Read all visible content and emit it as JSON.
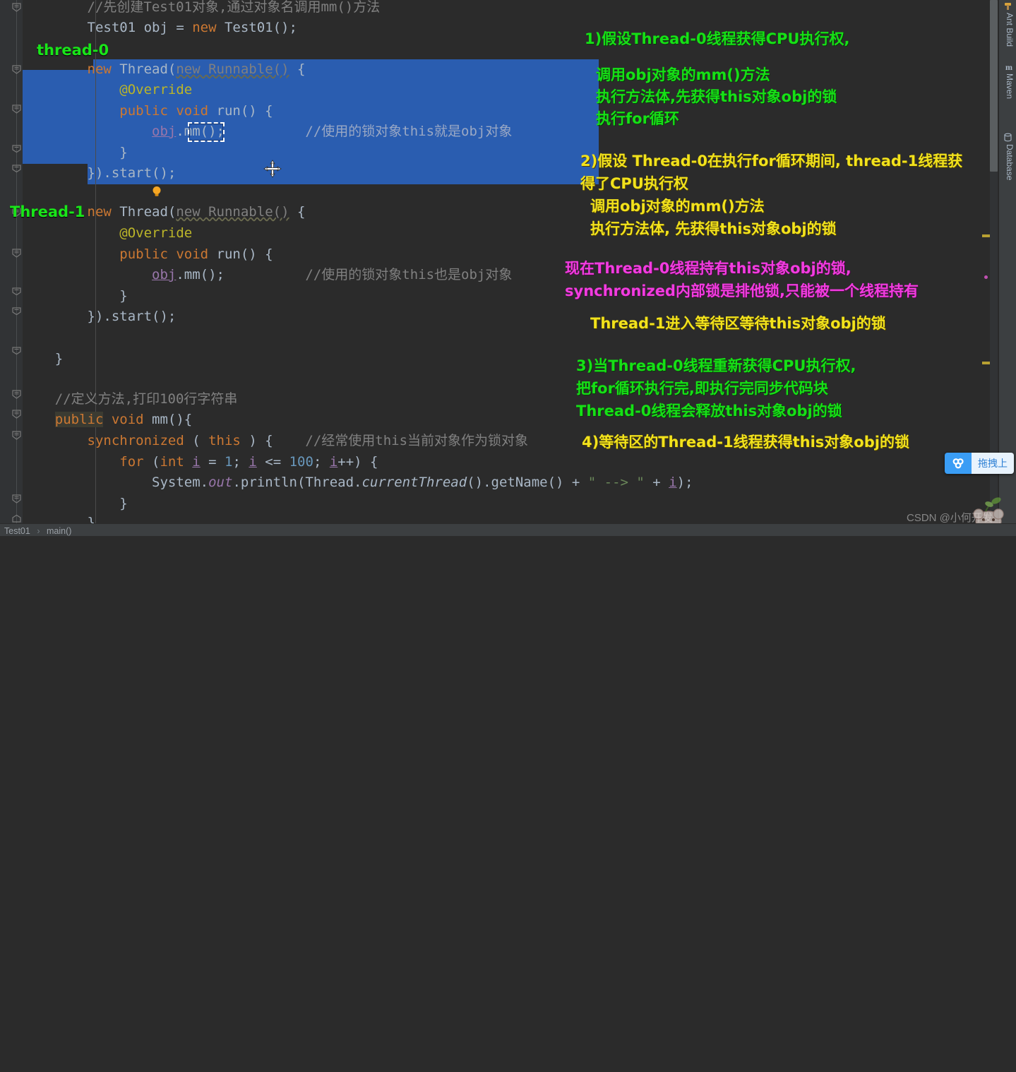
{
  "app": {
    "theme_bg": "#2b2b2b",
    "selection_color": "#2a5db0",
    "accent_green": "#16e016",
    "accent_yellow": "#f2e21c",
    "accent_magenta": "#f23ce0"
  },
  "editor": {
    "lines": [
      {
        "id": "l1",
        "text": "        //先创建Test01对象,通过对象名调用mm()方法"
      },
      {
        "id": "l2",
        "text": "        Test01 obj = new Test01();"
      },
      {
        "id": "l3",
        "text": ""
      },
      {
        "id": "l4",
        "text": "        new Thread(new Runnable() {"
      },
      {
        "id": "l5",
        "text": "            @Override"
      },
      {
        "id": "l6",
        "text": "            public void run() {"
      },
      {
        "id": "l7",
        "text": "                obj.mm();          //使用的锁对象this就是obj对象"
      },
      {
        "id": "l8",
        "text": "            }"
      },
      {
        "id": "l9",
        "text": "        }).start();"
      },
      {
        "id": "l10",
        "text": ""
      },
      {
        "id": "l11",
        "text": "        new Thread(new Runnable() {"
      },
      {
        "id": "l12",
        "text": "            @Override"
      },
      {
        "id": "l13",
        "text": "            public void run() {"
      },
      {
        "id": "l14",
        "text": "                obj.mm();          //使用的锁对象this也是obj对象"
      },
      {
        "id": "l15",
        "text": "            }"
      },
      {
        "id": "l16",
        "text": "        }).start();"
      },
      {
        "id": "l17",
        "text": ""
      },
      {
        "id": "l18",
        "text": "    }"
      },
      {
        "id": "l19",
        "text": ""
      },
      {
        "id": "l20",
        "text": "    //定义方法,打印100行字符串"
      },
      {
        "id": "l21",
        "text": "    public void mm(){"
      },
      {
        "id": "l22",
        "text": "        synchronized ( this ) {    //经常使用this当前对象作为锁对象"
      },
      {
        "id": "l23",
        "text": "            for (int i = 1; i <= 100; i++) {"
      },
      {
        "id": "l24",
        "text": "                System.out.println(Thread.currentThread().getName() + \" --> \" + i);"
      },
      {
        "id": "l25",
        "text": "            }"
      },
      {
        "id": "l26",
        "text": "        }"
      }
    ],
    "comment_l1": "//先创建Test01对象,通过对象名调用mm()方法",
    "comment_l7": "//使用的锁对象this就是obj对象",
    "comment_l14": "//使用的锁对象this也是obj对象",
    "comment_l20": "//定义方法,打印100行字符串",
    "comment_l22": "//经常使用this当前对象作为锁对象",
    "selected_token": "obj"
  },
  "thread_labels": {
    "thread0": "thread-0",
    "thread1": "Thread-1"
  },
  "annotations": [
    {
      "id": "a1",
      "color": "green",
      "text": "1)假设Thread-0线程获得CPU执行权,"
    },
    {
      "id": "a2",
      "color": "green",
      "text": "调用obj对象的mm()方法"
    },
    {
      "id": "a3",
      "color": "green",
      "text": "执行方法体,先获得this对象obj的锁"
    },
    {
      "id": "a4",
      "color": "green",
      "text": "执行for循环"
    },
    {
      "id": "a5",
      "color": "yellow",
      "text": "2)假设 Thread-0在执行for循环期间, thread-1线程获"
    },
    {
      "id": "a6",
      "color": "yellow",
      "text": "得了CPU执行权"
    },
    {
      "id": "a7",
      "color": "yellow",
      "text": "调用obj对象的mm()方法"
    },
    {
      "id": "a8",
      "color": "yellow",
      "text": "执行方法体, 先获得this对象obj的锁"
    },
    {
      "id": "a9",
      "color": "magenta",
      "text": "现在Thread-0线程持有this对象obj的锁,"
    },
    {
      "id": "a10",
      "color": "magenta",
      "text": "synchronized内部锁是排他锁,只能被一个线程持有"
    },
    {
      "id": "a11",
      "color": "yellow",
      "text": "Thread-1进入等待区等待this对象obj的锁"
    },
    {
      "id": "a12",
      "color": "green",
      "text": "3)当Thread-0线程重新获得CPU执行权,"
    },
    {
      "id": "a13",
      "color": "green",
      "text": "把for循环执行完,即执行完同步代码块"
    },
    {
      "id": "a14",
      "color": "green",
      "text": "Thread-0线程会释放this对象obj的锁"
    },
    {
      "id": "a15",
      "color": "yellow",
      "text": "4)等待区的Thread-1线程获得this对象obj的锁"
    }
  ],
  "right_toolbar": {
    "tabs": [
      {
        "id": "ant",
        "label": "Ant Build",
        "icon": "hammer-icon"
      },
      {
        "id": "maven",
        "label": "Maven",
        "icon": "maven-icon"
      },
      {
        "id": "database",
        "label": "Database",
        "icon": "database-icon"
      }
    ]
  },
  "breadcrumb": {
    "items": [
      "Test01",
      "main()"
    ],
    "separator": "›"
  },
  "upload_widget": {
    "icon": "cloud-upload-icon",
    "label": "拖拽上"
  },
  "watermark": {
    "text": "CSDN @小何开发"
  }
}
